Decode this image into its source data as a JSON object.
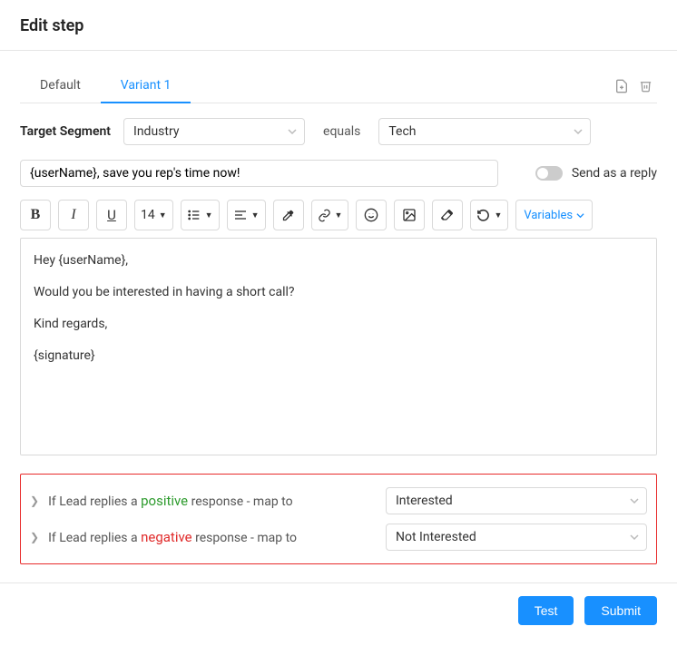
{
  "title": "Edit step",
  "tabs": [
    {
      "label": "Default",
      "active": false
    },
    {
      "label": "Variant 1",
      "active": true
    }
  ],
  "target_segment": {
    "label": "Target Segment",
    "field": "Industry",
    "operator": "equals",
    "value": "Tech"
  },
  "subject": "{userName}, save you rep's time now!",
  "send_as_reply": {
    "label": "Send as a reply",
    "enabled": false
  },
  "toolbar": {
    "font_size": "14",
    "variables_label": "Variables"
  },
  "body": {
    "line1": "Hey {userName},",
    "line2": "Would you be interested in having a short call?",
    "line3": "Kind regards,",
    "line4": "{signature}"
  },
  "mapping": {
    "positive": {
      "prefix": "If Lead replies a",
      "keyword": "positive",
      "suffix": "response - map to",
      "value": "Interested"
    },
    "negative": {
      "prefix": "If Lead replies a",
      "keyword": "negative",
      "suffix": "response - map to",
      "value": "Not Interested"
    }
  },
  "buttons": {
    "test": "Test",
    "submit": "Submit"
  }
}
